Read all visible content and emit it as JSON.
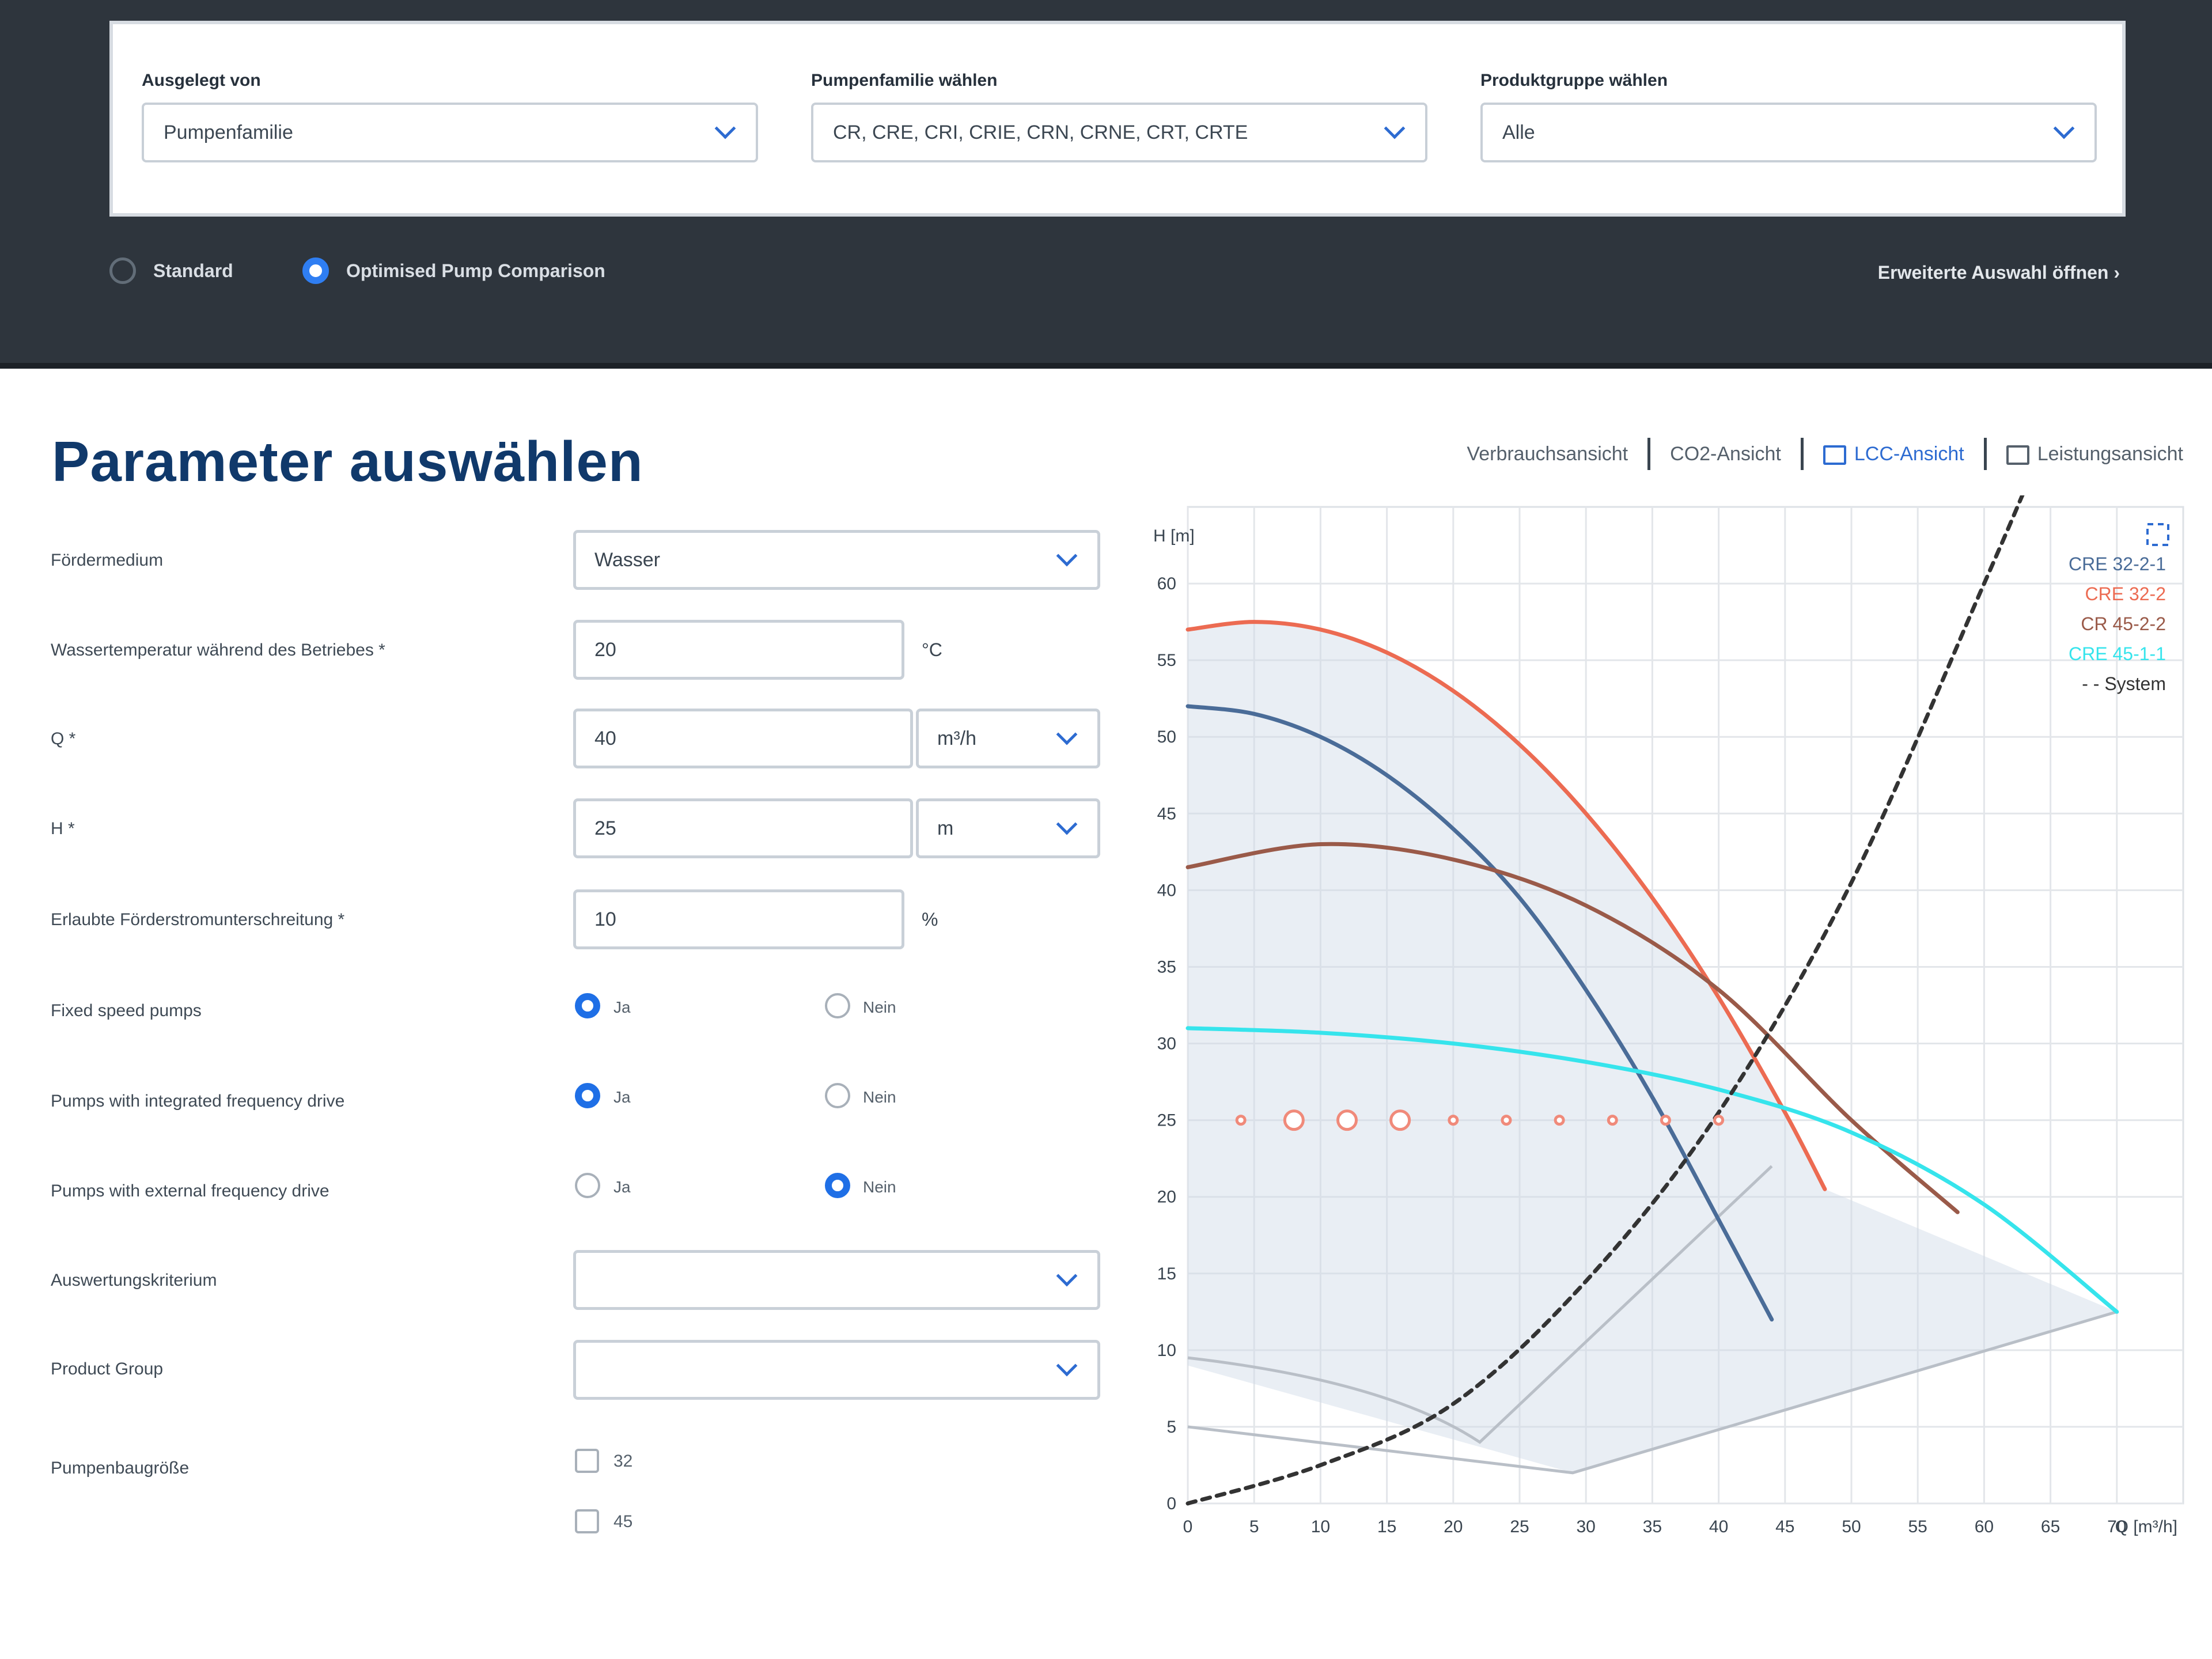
{
  "header": {
    "filters": [
      {
        "label": "Ausgelegt von",
        "value": "Pumpenfamilie"
      },
      {
        "label": "Pumpenfamilie wählen",
        "value": "CR, CRE, CRI, CRIE, CRN, CRNE, CRT, CRTE"
      },
      {
        "label": "Produktgruppe wählen",
        "value": "Alle"
      }
    ],
    "modes": [
      {
        "label": "Standard",
        "selected": false
      },
      {
        "label": "Optimised Pump Comparison",
        "selected": true
      }
    ],
    "advanced_link": "Erweiterte Auswahl öffnen ›"
  },
  "main": {
    "title": "Parameter auswählen",
    "views": [
      "Verbrauchsansicht",
      "CO2-Ansicht",
      "LCC-Ansicht",
      "Leistungsansicht"
    ],
    "active_view": "LCC-Ansicht",
    "fields": {
      "medium": {
        "label": "Fördermedium",
        "value": "Wasser"
      },
      "temperature": {
        "label": "Wassertemperatur während des Betriebes *",
        "value": "20",
        "unit": "°C"
      },
      "flow": {
        "label": "Q *",
        "value": "40",
        "unit": "m³/h"
      },
      "head": {
        "label": "H *",
        "value": "25",
        "unit": "m"
      },
      "tolerance": {
        "label": "Erlaubte Förderstromunterschreitung *",
        "value": "10",
        "unit": "%"
      },
      "fixed_speed": {
        "label": "Fixed speed pumps",
        "yes": "Ja",
        "no": "Nein",
        "selected": "yes"
      },
      "integrated_drive": {
        "label": "Pumps with integrated frequency drive",
        "yes": "Ja",
        "no": "Nein",
        "selected": "yes"
      },
      "external_drive": {
        "label": "Pumps with external frequency drive",
        "yes": "Ja",
        "no": "Nein",
        "selected": "no"
      },
      "criterion": {
        "label": "Auswertungskriterium",
        "value": ""
      },
      "product_group": {
        "label": "Product Group",
        "value": ""
      },
      "pump_size": {
        "label": "Pumpenbaugröße",
        "options": [
          "32",
          "45"
        ]
      }
    }
  },
  "chart_data": {
    "type": "line",
    "ylabel": "H [m]",
    "xlabel": "Q [m³/h]",
    "xlim": [
      0,
      75
    ],
    "ylim": [
      0,
      65
    ],
    "xticks": [
      0,
      5,
      10,
      15,
      20,
      25,
      30,
      35,
      40,
      45,
      50,
      55,
      60,
      65,
      70
    ],
    "yticks": [
      0,
      5,
      10,
      15,
      20,
      25,
      30,
      35,
      40,
      45,
      50,
      55,
      60
    ],
    "x_tick_last_label": "Q [m³/h]",
    "grid": true,
    "legend_position": "top-right",
    "series": [
      {
        "name": "CRE 32-2-1",
        "color": "#4a6c98",
        "x": [
          0,
          5,
          10,
          15,
          20,
          25,
          30,
          35,
          40,
          44
        ],
        "y": [
          52,
          51.5,
          50,
          47.5,
          44,
          39.5,
          33.5,
          26.5,
          18.5,
          12
        ]
      },
      {
        "name": "CRE 32-2",
        "color": "#ec6b52",
        "x": [
          0,
          5,
          10,
          15,
          20,
          25,
          30,
          35,
          40,
          45,
          48
        ],
        "y": [
          57,
          57.5,
          57,
          55.5,
          53,
          49.5,
          45,
          39.5,
          33,
          25.5,
          20.5
        ]
      },
      {
        "name": "CR 45-2-2",
        "color": "#9a5a49",
        "x": [
          0,
          10,
          20,
          30,
          40,
          50,
          58
        ],
        "y": [
          41.5,
          43,
          42,
          39,
          33.5,
          25,
          19
        ]
      },
      {
        "name": "CRE 45-1-1",
        "color": "#36e4ec",
        "x": [
          0,
          10,
          20,
          30,
          40,
          50,
          60,
          70
        ],
        "y": [
          31,
          30.7,
          30,
          28.8,
          27,
          24.2,
          19.5,
          12.5
        ]
      },
      {
        "name": "- - System",
        "color": "#333333",
        "dashed": true,
        "x": [
          0,
          10,
          20,
          30,
          40,
          50,
          60,
          63
        ],
        "y": [
          0,
          2.5,
          6.5,
          14.5,
          25.5,
          40.5,
          60,
          66
        ]
      }
    ],
    "duty_points": {
      "x": [
        4,
        8,
        12,
        16,
        20,
        24,
        28,
        32,
        36,
        40
      ],
      "y": 25
    }
  }
}
